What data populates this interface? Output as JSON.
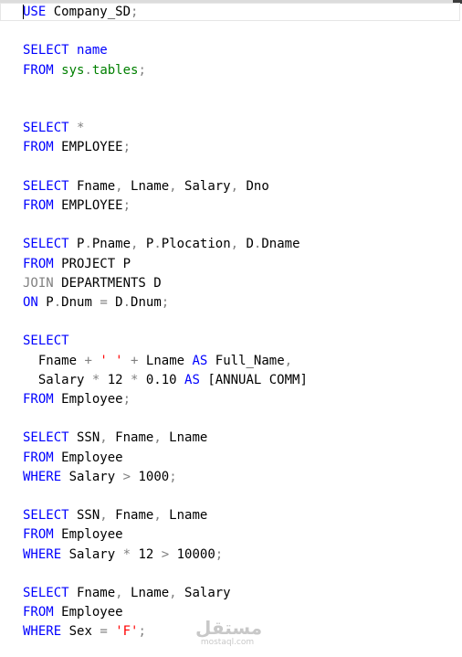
{
  "editor": {
    "lines": [
      [
        {
          "t": "USE",
          "c": "kw"
        },
        {
          "t": " Company_SD",
          "c": "ident"
        },
        {
          "t": ";",
          "c": "op"
        }
      ],
      [],
      [
        {
          "t": "SELECT",
          "c": "kw"
        },
        {
          "t": " ",
          "c": "ident"
        },
        {
          "t": "name",
          "c": "kw"
        }
      ],
      [
        {
          "t": "FROM",
          "c": "kw"
        },
        {
          "t": " ",
          "c": "ident"
        },
        {
          "t": "sys",
          "c": "sys"
        },
        {
          "t": ".",
          "c": "op"
        },
        {
          "t": "tables",
          "c": "sys"
        },
        {
          "t": ";",
          "c": "op"
        }
      ],
      [],
      [],
      [
        {
          "t": "SELECT",
          "c": "kw"
        },
        {
          "t": " ",
          "c": "ident"
        },
        {
          "t": "*",
          "c": "op"
        }
      ],
      [
        {
          "t": "FROM",
          "c": "kw"
        },
        {
          "t": " EMPLOYEE",
          "c": "ident"
        },
        {
          "t": ";",
          "c": "op"
        }
      ],
      [],
      [
        {
          "t": "SELECT",
          "c": "kw"
        },
        {
          "t": " Fname",
          "c": "ident"
        },
        {
          "t": ",",
          "c": "op"
        },
        {
          "t": " Lname",
          "c": "ident"
        },
        {
          "t": ",",
          "c": "op"
        },
        {
          "t": " Salary",
          "c": "ident"
        },
        {
          "t": ",",
          "c": "op"
        },
        {
          "t": " Dno",
          "c": "ident"
        }
      ],
      [
        {
          "t": "FROM",
          "c": "kw"
        },
        {
          "t": " EMPLOYEE",
          "c": "ident"
        },
        {
          "t": ";",
          "c": "op"
        }
      ],
      [],
      [
        {
          "t": "SELECT",
          "c": "kw"
        },
        {
          "t": " P",
          "c": "ident"
        },
        {
          "t": ".",
          "c": "op"
        },
        {
          "t": "Pname",
          "c": "ident"
        },
        {
          "t": ",",
          "c": "op"
        },
        {
          "t": " P",
          "c": "ident"
        },
        {
          "t": ".",
          "c": "op"
        },
        {
          "t": "Plocation",
          "c": "ident"
        },
        {
          "t": ",",
          "c": "op"
        },
        {
          "t": " D",
          "c": "ident"
        },
        {
          "t": ".",
          "c": "op"
        },
        {
          "t": "Dname",
          "c": "ident"
        }
      ],
      [
        {
          "t": "FROM",
          "c": "kw"
        },
        {
          "t": " PROJECT P",
          "c": "ident"
        }
      ],
      [
        {
          "t": "JOIN",
          "c": "op"
        },
        {
          "t": " DEPARTMENTS D",
          "c": "ident"
        }
      ],
      [
        {
          "t": "ON",
          "c": "kw"
        },
        {
          "t": " P",
          "c": "ident"
        },
        {
          "t": ".",
          "c": "op"
        },
        {
          "t": "Dnum ",
          "c": "ident"
        },
        {
          "t": "=",
          "c": "op"
        },
        {
          "t": " D",
          "c": "ident"
        },
        {
          "t": ".",
          "c": "op"
        },
        {
          "t": "Dnum",
          "c": "ident"
        },
        {
          "t": ";",
          "c": "op"
        }
      ],
      [],
      [
        {
          "t": "SELECT",
          "c": "kw"
        }
      ],
      [
        {
          "t": "  Fname ",
          "c": "ident"
        },
        {
          "t": "+",
          "c": "op"
        },
        {
          "t": " ",
          "c": "ident"
        },
        {
          "t": "' '",
          "c": "str"
        },
        {
          "t": " ",
          "c": "ident"
        },
        {
          "t": "+",
          "c": "op"
        },
        {
          "t": " Lname ",
          "c": "ident"
        },
        {
          "t": "AS",
          "c": "kw"
        },
        {
          "t": " Full_Name",
          "c": "ident"
        },
        {
          "t": ",",
          "c": "op"
        }
      ],
      [
        {
          "t": "  Salary ",
          "c": "ident"
        },
        {
          "t": "*",
          "c": "op"
        },
        {
          "t": " 12 ",
          "c": "ident"
        },
        {
          "t": "*",
          "c": "op"
        },
        {
          "t": " 0.10 ",
          "c": "ident"
        },
        {
          "t": "AS",
          "c": "kw"
        },
        {
          "t": " [ANNUAL COMM]",
          "c": "ident"
        }
      ],
      [
        {
          "t": "FROM",
          "c": "kw"
        },
        {
          "t": " Employee",
          "c": "ident"
        },
        {
          "t": ";",
          "c": "op"
        }
      ],
      [],
      [
        {
          "t": "SELECT",
          "c": "kw"
        },
        {
          "t": " SSN",
          "c": "ident"
        },
        {
          "t": ",",
          "c": "op"
        },
        {
          "t": " Fname",
          "c": "ident"
        },
        {
          "t": ",",
          "c": "op"
        },
        {
          "t": " Lname",
          "c": "ident"
        }
      ],
      [
        {
          "t": "FROM",
          "c": "kw"
        },
        {
          "t": " Employee",
          "c": "ident"
        }
      ],
      [
        {
          "t": "WHERE",
          "c": "kw"
        },
        {
          "t": " Salary ",
          "c": "ident"
        },
        {
          "t": ">",
          "c": "op"
        },
        {
          "t": " 1000",
          "c": "ident"
        },
        {
          "t": ";",
          "c": "op"
        }
      ],
      [],
      [
        {
          "t": "SELECT",
          "c": "kw"
        },
        {
          "t": " SSN",
          "c": "ident"
        },
        {
          "t": ",",
          "c": "op"
        },
        {
          "t": " Fname",
          "c": "ident"
        },
        {
          "t": ",",
          "c": "op"
        },
        {
          "t": " Lname",
          "c": "ident"
        }
      ],
      [
        {
          "t": "FROM",
          "c": "kw"
        },
        {
          "t": " Employee",
          "c": "ident"
        }
      ],
      [
        {
          "t": "WHERE",
          "c": "kw"
        },
        {
          "t": " Salary ",
          "c": "ident"
        },
        {
          "t": "*",
          "c": "op"
        },
        {
          "t": " 12 ",
          "c": "ident"
        },
        {
          "t": ">",
          "c": "op"
        },
        {
          "t": " 10000",
          "c": "ident"
        },
        {
          "t": ";",
          "c": "op"
        }
      ],
      [],
      [
        {
          "t": "SELECT",
          "c": "kw"
        },
        {
          "t": " Fname",
          "c": "ident"
        },
        {
          "t": ",",
          "c": "op"
        },
        {
          "t": " Lname",
          "c": "ident"
        },
        {
          "t": ",",
          "c": "op"
        },
        {
          "t": " Salary",
          "c": "ident"
        }
      ],
      [
        {
          "t": "FROM",
          "c": "kw"
        },
        {
          "t": " Employee",
          "c": "ident"
        }
      ],
      [
        {
          "t": "WHERE",
          "c": "kw"
        },
        {
          "t": " Sex ",
          "c": "ident"
        },
        {
          "t": "=",
          "c": "op"
        },
        {
          "t": " ",
          "c": "ident"
        },
        {
          "t": "'F'",
          "c": "str"
        },
        {
          "t": ";",
          "c": "op"
        }
      ]
    ],
    "colors": {
      "keyword": "#0000ff",
      "operator": "#808080",
      "string": "#ff0000",
      "system_object": "#008000",
      "text": "#000000"
    }
  },
  "watermark": {
    "main": "مستقل",
    "sub": "mostaql.com"
  }
}
